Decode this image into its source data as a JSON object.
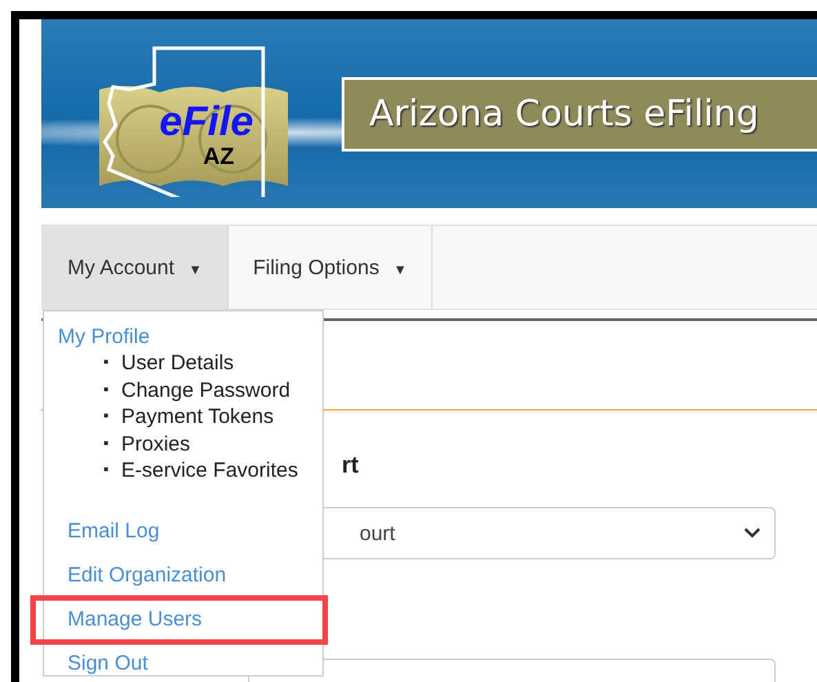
{
  "banner": {
    "logo_text": "eFile",
    "logo_subtext": "AZ",
    "title": "Arizona Courts eFiling"
  },
  "nav": {
    "tabs": [
      {
        "label": "My Account",
        "caret": "▼",
        "selected": true
      },
      {
        "label": "Filing Options",
        "caret": "▼",
        "selected": false
      }
    ]
  },
  "menu": {
    "heading": "My Profile",
    "subitems": [
      {
        "bullet": "▪",
        "label": "User Details"
      },
      {
        "bullet": "▪",
        "label": "Change Password"
      },
      {
        "bullet": "▪",
        "label": "Payment Tokens"
      },
      {
        "bullet": "▪",
        "label": "Proxies"
      },
      {
        "bullet": "▪",
        "label": "E-service Favorites"
      }
    ],
    "links": [
      {
        "label": "Email Log",
        "highlighted": false
      },
      {
        "label": "Edit Organization",
        "highlighted": false
      },
      {
        "label": "Manage Users",
        "highlighted": true
      },
      {
        "label": "Sign Out",
        "highlighted": false
      }
    ]
  },
  "content": {
    "heading_fragment": "rt",
    "select_value": "ourt"
  }
}
